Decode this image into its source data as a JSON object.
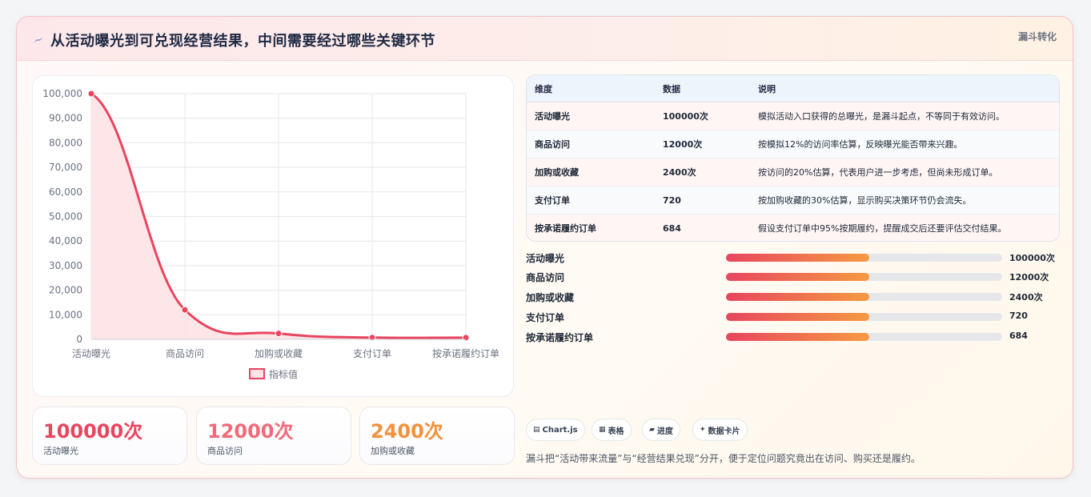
{
  "header": {
    "title": "从活动曝光到可兑现经营结果，中间需要经过哪些关键环节",
    "tag": "漏斗转化",
    "icon": "bolt-icon"
  },
  "chart_data": {
    "type": "line",
    "categories": [
      "活动曝光",
      "商品访问",
      "加购或收藏",
      "支付订单",
      "按承诺履约订单"
    ],
    "series": [
      {
        "name": "指标值",
        "values": [
          100000,
          12000,
          2400,
          720,
          684
        ]
      }
    ],
    "y_ticks": [
      "0",
      "10,000",
      "20,000",
      "30,000",
      "40,000",
      "50,000",
      "60,000",
      "70,000",
      "80,000",
      "90,000",
      "100,000"
    ],
    "ylim": [
      0,
      100000
    ],
    "grid": true,
    "legend": "bottom",
    "color": "#e8455f",
    "fill": "#fde2e6"
  },
  "kpis": [
    {
      "value": "100000次",
      "label": "活动曝光",
      "color": "#e8455f"
    },
    {
      "value": "12000次",
      "label": "商品访问",
      "color": "#f06a7a"
    },
    {
      "value": "2400次",
      "label": "加购或收藏",
      "color": "#f5913a"
    }
  ],
  "table": {
    "headers": [
      "维度",
      "数据",
      "说明"
    ],
    "rows": [
      [
        "活动曝光",
        "100000次",
        "模拟活动入口获得的总曝光，是漏斗起点，不等同于有效访问。"
      ],
      [
        "商品访问",
        "12000次",
        "按模拟12%的访问率估算，反映曝光能否带来兴趣。"
      ],
      [
        "加购或收藏",
        "2400次",
        "按访问的20%估算，代表用户进一步考虑，但尚未形成订单。"
      ],
      [
        "支付订单",
        "720",
        "按加购收藏的30%估算，显示购买决策环节仍会流失。"
      ],
      [
        "按承诺履约订单",
        "684",
        "假设支付订单中95%按期履约，提醒成交后还要评估交付结果。"
      ]
    ]
  },
  "progress": [
    {
      "label": "活动曝光",
      "value": "100000次",
      "fraction": 0.52
    },
    {
      "label": "商品访问",
      "value": "12000次",
      "fraction": 0.52
    },
    {
      "label": "加购或收藏",
      "value": "2400次",
      "fraction": 0.52
    },
    {
      "label": "支付订单",
      "value": "720",
      "fraction": 0.52
    },
    {
      "label": "按承诺履约订单",
      "value": "684",
      "fraction": 0.52
    }
  ],
  "chips": [
    {
      "icon": "chart-icon",
      "glyph": "▤",
      "label": "Chart.js"
    },
    {
      "icon": "table-icon",
      "glyph": "▦",
      "label": "表格"
    },
    {
      "icon": "progress-icon",
      "glyph": "▰",
      "label": "进度"
    },
    {
      "icon": "sparkle-icon",
      "glyph": "✦",
      "label": "数据卡片"
    }
  ],
  "footnote": "漏斗把“活动带来流量”与“经营结果兑现”分开，便于定位问题究竟出在访问、购买还是履约。"
}
